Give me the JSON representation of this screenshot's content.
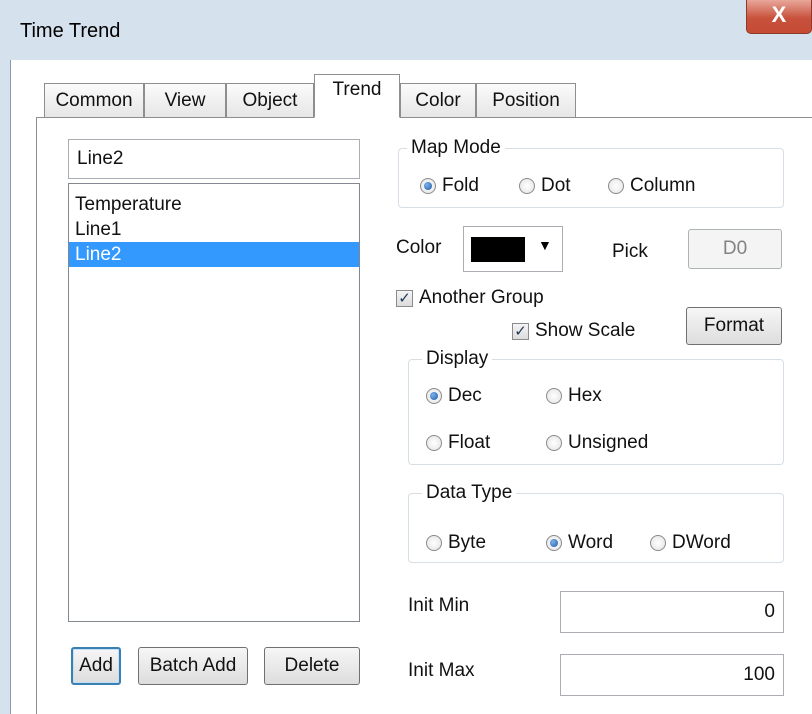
{
  "window": {
    "title": "Time Trend",
    "close_label": "X",
    "accent_color": "#c8523d"
  },
  "tabs": [
    {
      "label": "Common",
      "active": false
    },
    {
      "label": "View",
      "active": false
    },
    {
      "label": "Object",
      "active": false
    },
    {
      "label": "Trend",
      "active": true
    },
    {
      "label": "Color",
      "active": false
    },
    {
      "label": "Position",
      "active": false
    }
  ],
  "trend": {
    "name_value": "Line2",
    "lines": [
      "Temperature",
      "Line1",
      "Line2"
    ],
    "selected_line": "Line2",
    "selection_color": "#3399ff",
    "buttons": {
      "add": "Add",
      "batch_add": "Batch Add",
      "delete": "Delete"
    },
    "map_mode": {
      "label": "Map Mode",
      "options": [
        "Fold",
        "Dot",
        "Column"
      ],
      "selected": "Fold"
    },
    "color": {
      "label": "Color",
      "value": "#000000"
    },
    "pick": {
      "label": "Pick",
      "value": "D0"
    },
    "another_group": {
      "label": "Another Group",
      "checked": true
    },
    "show_scale": {
      "label": "Show Scale",
      "checked": true
    },
    "format_button": "Format",
    "display": {
      "label": "Display",
      "options": [
        "Dec",
        "Hex",
        "Float",
        "Unsigned"
      ],
      "selected": "Dec"
    },
    "data_type": {
      "label": "Data Type",
      "options": [
        "Byte",
        "Word",
        "DWord"
      ],
      "selected": "Word"
    },
    "init_min": {
      "label": "Init Min",
      "value": "0"
    },
    "init_max": {
      "label": "Init Max",
      "value": "100"
    }
  },
  "icons": {
    "close": "close-icon",
    "dropdown": "chevron-down-icon",
    "check": "checkmark-icon"
  }
}
